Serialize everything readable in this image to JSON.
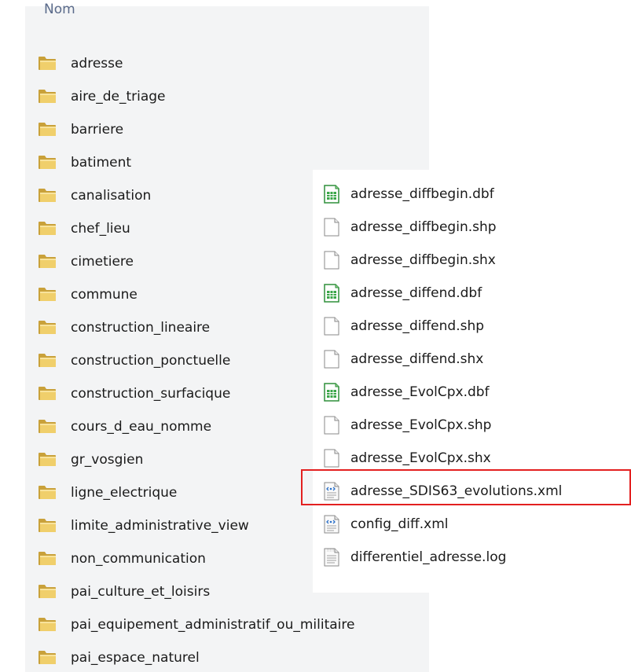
{
  "column_header": "Nom",
  "folders": [
    "adresse",
    "aire_de_triage",
    "barriere",
    "batiment",
    "canalisation",
    "chef_lieu",
    "cimetiere",
    "commune",
    "construction_lineaire",
    "construction_ponctuelle",
    "construction_surfacique",
    "cours_d_eau_nomme",
    "gr_vosgien",
    "ligne_electrique",
    "limite_administrative_view",
    "non_communication",
    "pai_culture_et_loisirs",
    "pai_equipement_administratif_ou_militaire",
    "pai_espace_naturel"
  ],
  "files": [
    {
      "name": "adresse_diffbegin.dbf",
      "icon": "spreadsheet-icon"
    },
    {
      "name": "adresse_diffbegin.shp",
      "icon": "blank-file-icon"
    },
    {
      "name": "adresse_diffbegin.shx",
      "icon": "blank-file-icon"
    },
    {
      "name": "adresse_diffend.dbf",
      "icon": "spreadsheet-icon"
    },
    {
      "name": "adresse_diffend.shp",
      "icon": "blank-file-icon"
    },
    {
      "name": "adresse_diffend.shx",
      "icon": "blank-file-icon"
    },
    {
      "name": "adresse_EvolCpx.dbf",
      "icon": "spreadsheet-icon"
    },
    {
      "name": "adresse_EvolCpx.shp",
      "icon": "blank-file-icon"
    },
    {
      "name": "adresse_EvolCpx.shx",
      "icon": "blank-file-icon"
    },
    {
      "name": "adresse_SDIS63_evolutions.xml",
      "icon": "xml-file-icon"
    },
    {
      "name": "config_diff.xml",
      "icon": "xml-file-icon"
    },
    {
      "name": "differentiel_adresse.log",
      "icon": "text-file-icon"
    }
  ],
  "highlighted_file": "adresse_SDIS63_evolutions.xml",
  "colors": {
    "highlight": "#e32020",
    "folder": "#e8c25a",
    "panel_bg": "#f3f4f5"
  }
}
